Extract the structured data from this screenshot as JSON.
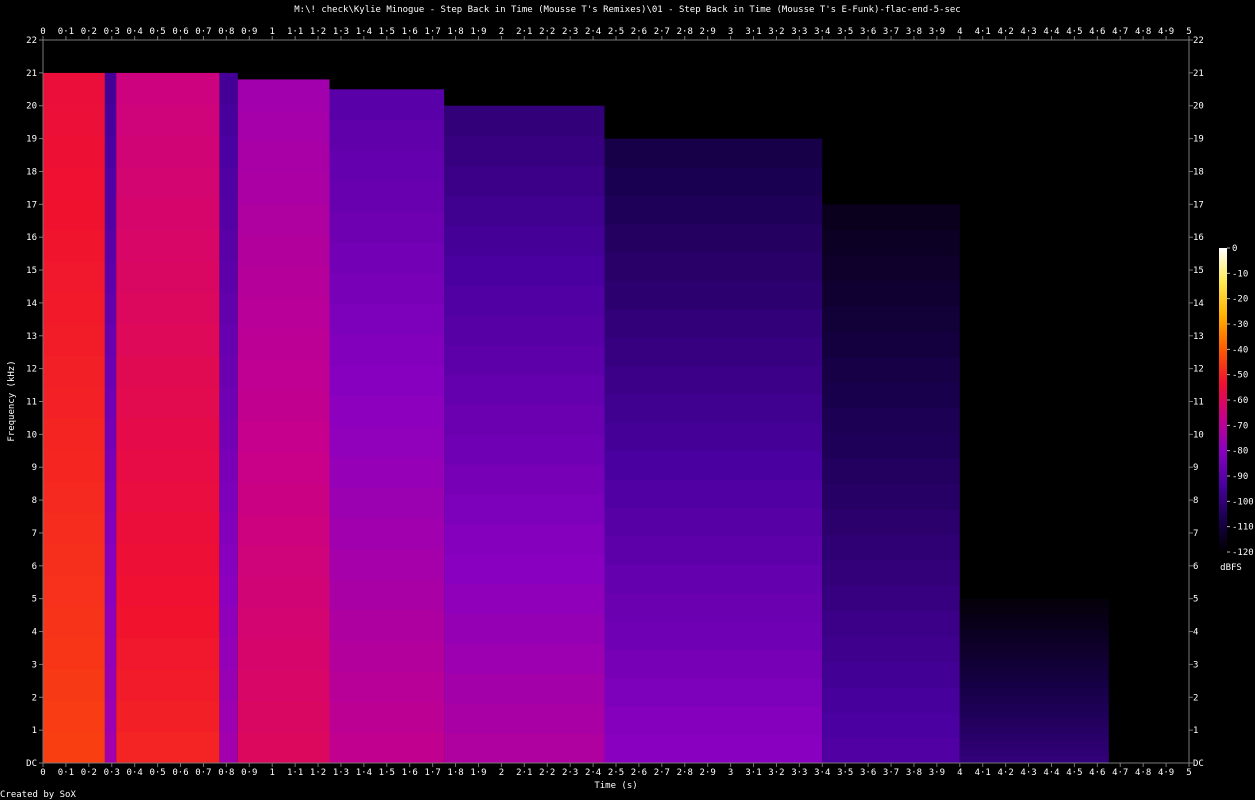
{
  "chart_data": {
    "type": "heatmap",
    "title": "M:\\! check\\Kylie Minogue - Step Back in Time (Mousse T's Remixes)\\01 - Step Back in Time (Mousse T's E-Funk)-flac-end-5-sec",
    "xlabel": "Time (s)",
    "ylabel": "Frequency (kHz)",
    "xlim": [
      0,
      5
    ],
    "ylim": [
      0,
      22
    ],
    "x_ticks": [
      "0",
      "0·1",
      "0·2",
      "0·3",
      "0·4",
      "0·5",
      "0·6",
      "0·7",
      "0·8",
      "0·9",
      "1",
      "1·1",
      "1·2",
      "1·3",
      "1·4",
      "1·5",
      "1·6",
      "1·7",
      "1·8",
      "1·9",
      "2",
      "2·1",
      "2·2",
      "2·3",
      "2·4",
      "2·5",
      "2·6",
      "2·7",
      "2·8",
      "2·9",
      "3",
      "3·1",
      "3·2",
      "3·3",
      "3·4",
      "3·5",
      "3·6",
      "3·7",
      "3·8",
      "3·9",
      "4",
      "4·1",
      "4·2",
      "4·3",
      "4·4",
      "4·5",
      "4·6",
      "4·7",
      "4·8",
      "4·9",
      "5"
    ],
    "y_ticks": [
      "DC",
      "1",
      "2",
      "3",
      "4",
      "5",
      "6",
      "7",
      "8",
      "9",
      "10",
      "11",
      "12",
      "13",
      "14",
      "15",
      "16",
      "17",
      "18",
      "19",
      "20",
      "21",
      "22"
    ],
    "colorbar": {
      "label": "dBFS",
      "ticks": [
        "0",
        "-10",
        "-20",
        "-30",
        "-40",
        "-50",
        "-60",
        "-70",
        "-80",
        "-90",
        "-100",
        "-110",
        "-120"
      ],
      "range": [
        -120,
        0
      ],
      "colors": [
        "#000000",
        "#1a0050",
        "#4a00a0",
        "#8a00c0",
        "#c8008a",
        "#f01030",
        "#ff5a00",
        "#ffb000",
        "#ffe850",
        "#ffffff"
      ]
    },
    "segments": [
      {
        "t0": 0.0,
        "t1": 0.27,
        "fmax": 21.0,
        "level_high": -55,
        "level_low": -45
      },
      {
        "t0": 0.27,
        "t1": 0.32,
        "fmax": 21.0,
        "level_high": -95,
        "level_low": -75
      },
      {
        "t0": 0.32,
        "t1": 0.77,
        "fmax": 21.0,
        "level_high": -65,
        "level_low": -50
      },
      {
        "t0": 0.77,
        "t1": 0.85,
        "fmax": 21.0,
        "level_high": -95,
        "level_low": -75
      },
      {
        "t0": 0.85,
        "t1": 1.25,
        "fmax": 20.8,
        "level_high": -75,
        "level_low": -60
      },
      {
        "t0": 1.25,
        "t1": 1.75,
        "fmax": 20.5,
        "level_high": -90,
        "level_low": -68
      },
      {
        "t0": 1.75,
        "t1": 2.45,
        "fmax": 20.0,
        "level_high": -100,
        "level_low": -72
      },
      {
        "t0": 2.45,
        "t1": 3.4,
        "fmax": 19.0,
        "level_high": -108,
        "level_low": -80
      },
      {
        "t0": 3.4,
        "t1": 4.0,
        "fmax": 17.0,
        "level_high": -115,
        "level_low": -92
      },
      {
        "t0": 4.0,
        "t1": 4.65,
        "fmax": 5.0,
        "level_high": -118,
        "level_low": -100
      }
    ]
  },
  "footer": "Created by SoX"
}
